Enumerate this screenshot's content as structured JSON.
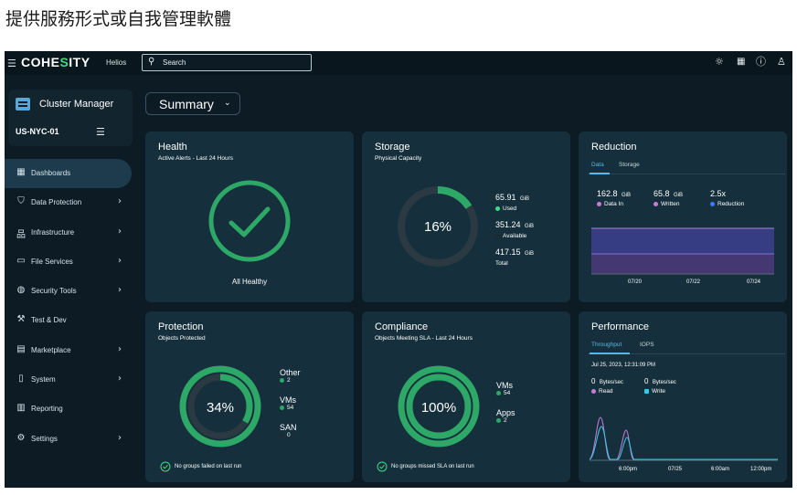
{
  "page_heading": "提供服務形式或自我管理軟體",
  "topbar": {
    "brand": "COHESITY",
    "product": "Helios",
    "search_placeholder": "Search"
  },
  "sidebar": {
    "cluster_title": "Cluster Manager",
    "cluster_name": "US-NYC-01",
    "items": [
      {
        "label": "Dashboards",
        "icon": "grid-icon",
        "active": true,
        "chevron": false
      },
      {
        "label": "Data Protection",
        "icon": "shield-icon",
        "active": false,
        "chevron": true
      },
      {
        "label": "Infrastructure",
        "icon": "hierarchy-icon",
        "active": false,
        "chevron": true
      },
      {
        "label": "File Services",
        "icon": "folder-icon",
        "active": false,
        "chevron": true
      },
      {
        "label": "Security Tools",
        "icon": "security-icon",
        "active": false,
        "chevron": true
      },
      {
        "label": "Test & Dev",
        "icon": "wrench-icon",
        "active": false,
        "chevron": false
      },
      {
        "label": "Marketplace",
        "icon": "store-icon",
        "active": false,
        "chevron": true
      },
      {
        "label": "System",
        "icon": "system-icon",
        "active": false,
        "chevron": true
      },
      {
        "label": "Reporting",
        "icon": "report-icon",
        "active": false,
        "chevron": false
      },
      {
        "label": "Settings",
        "icon": "gear-icon",
        "active": false,
        "chevron": true
      }
    ]
  },
  "summary_label": "Summary",
  "health": {
    "title": "Health",
    "subtitle": "Active Alerts - Last 24 Hours",
    "status": "All Healthy"
  },
  "storage": {
    "title": "Storage",
    "subtitle": "Physical Capacity",
    "percent_label": "16%",
    "percent": 16,
    "used_value": "65.91",
    "used_unit": "GiB",
    "used_label": "Used",
    "available_value": "351.24",
    "available_unit": "GiB",
    "available_label": "Available",
    "total_value": "417.15",
    "total_unit": "GiB",
    "total_label": "Total"
  },
  "reduction": {
    "title": "Reduction",
    "tabs": [
      "Data",
      "Storage"
    ],
    "stats": [
      {
        "value": "162.8",
        "unit": "GiB",
        "label": "Data In",
        "color": "#c77dd8"
      },
      {
        "value": "65.8",
        "unit": "GiB",
        "label": "Written",
        "color": "#c77dd8"
      },
      {
        "value": "2.5x",
        "unit": "",
        "label": "Reduction",
        "color": "#3b7bff"
      }
    ],
    "x_ticks": [
      "07/20",
      "07/22",
      "07/24"
    ]
  },
  "protection": {
    "title": "Protection",
    "subtitle": "Objects Protected",
    "percent_label": "34%",
    "legend": [
      {
        "name": "Other",
        "value": "2"
      },
      {
        "name": "VMs",
        "value": "54"
      },
      {
        "name": "SAN",
        "value": "0"
      }
    ],
    "footer": "No groups failed on last run"
  },
  "compliance": {
    "title": "Compliance",
    "subtitle": "Objects Meeting SLA - Last 24 Hours",
    "percent_label": "100%",
    "legend": [
      {
        "name": "VMs",
        "value": "54"
      },
      {
        "name": "Apps",
        "value": "2"
      }
    ],
    "footer": "No groups missed SLA on last run"
  },
  "performance": {
    "title": "Performance",
    "tabs": [
      "Throughput",
      "IOPS"
    ],
    "timestamp": "Jul 25, 2023, 12:31:09 PM",
    "read_value": "0",
    "read_unit": "Bytes/sec",
    "read_label": "Read",
    "write_value": "0",
    "write_unit": "Bytes/sec",
    "write_label": "Write",
    "x_ticks": [
      "6:00pm",
      "07/25",
      "6:00am",
      "12:00pm"
    ]
  },
  "colors": {
    "accent_green": "#3ddc84",
    "ring_green": "#2ea866",
    "tab_blue": "#5ab7e6",
    "read_purple": "#c77dd8",
    "write_cyan": "#3ec6e6"
  }
}
